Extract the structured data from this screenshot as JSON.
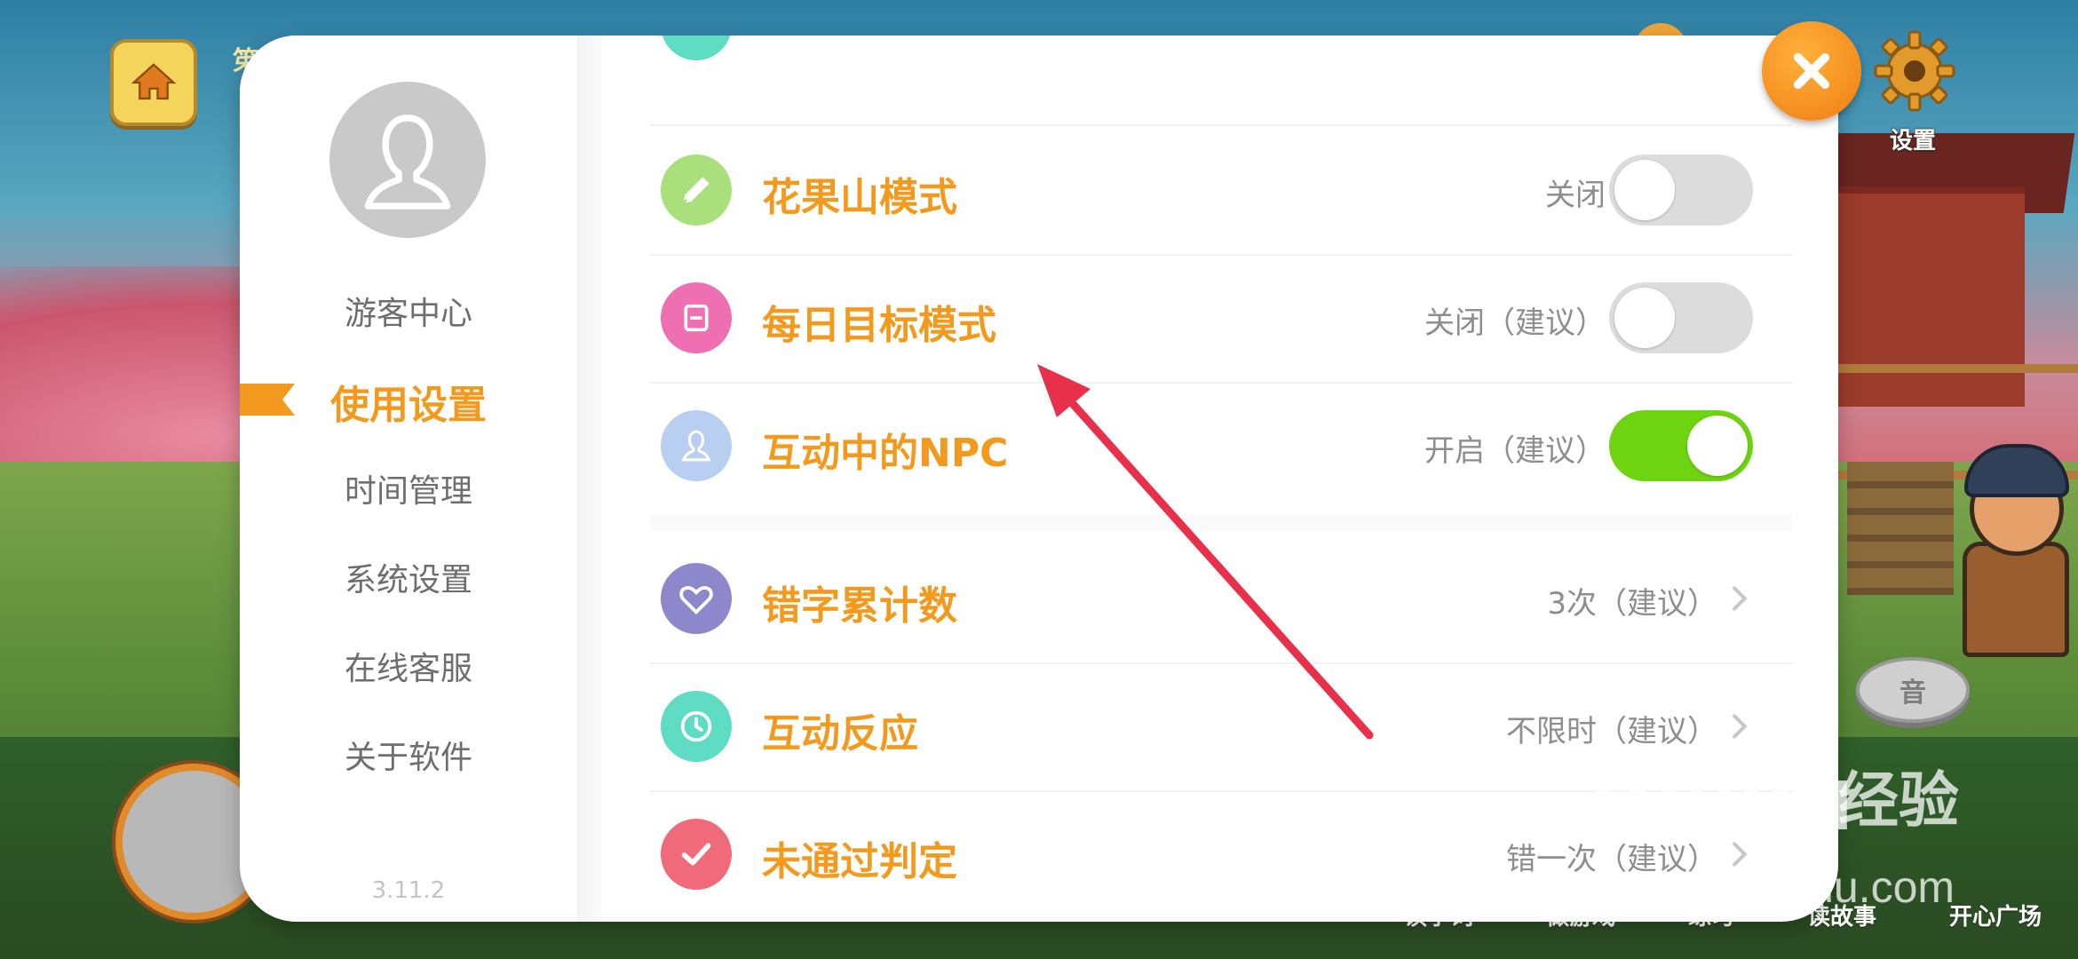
{
  "background": {
    "top_text": "笫",
    "settings_label": "设置",
    "sound_label": "音",
    "bottom_nav": [
      "读字词",
      "做游戏",
      "练习",
      "读故事",
      "开心广场"
    ]
  },
  "watermark": {
    "logo": "Baidu",
    "cn": "经验",
    "url": "jingyan.baidu.com"
  },
  "sidebar": {
    "items": [
      {
        "label": "游客中心",
        "active": false
      },
      {
        "label": "使用设置",
        "active": true
      },
      {
        "label": "时间管理",
        "active": false
      },
      {
        "label": "系统设置",
        "active": false
      },
      {
        "label": "在线客服",
        "active": false
      },
      {
        "label": "关于软件",
        "active": false
      }
    ],
    "version": "3.11.2"
  },
  "settings": [
    {
      "label": "花果山模式",
      "value": "关闭",
      "control": "toggle",
      "on": false,
      "icon": "pencil-icon",
      "icon_color": "#a9e07c"
    },
    {
      "label": "每日目标模式",
      "value": "关闭（建议）",
      "control": "toggle",
      "on": false,
      "icon": "calendar-icon",
      "icon_color": "#ee6fb2"
    },
    {
      "label": "互动中的NPC",
      "value": "开启（建议）",
      "control": "toggle",
      "on": true,
      "icon": "person-icon",
      "icon_color": "#b9cff2"
    },
    {
      "label": "错字累计数",
      "value": "3次（建议）",
      "control": "arrow",
      "icon": "heart-icon",
      "icon_color": "#8d87cc"
    },
    {
      "label": "互动反应",
      "value": "不限时（建议）",
      "control": "arrow",
      "icon": "clock-icon",
      "icon_color": "#5fdcc4"
    },
    {
      "label": "未通过判定",
      "value": "错一次（建议）",
      "control": "arrow",
      "icon": "check-icon",
      "icon_color": "#f06a7a"
    }
  ],
  "colors": {
    "accent": "#f39a1e",
    "toggle_on": "#6ed310",
    "toggle_off": "#dcdcdc",
    "close": "#f07d10",
    "annotation_arrow": "#e8304a"
  }
}
